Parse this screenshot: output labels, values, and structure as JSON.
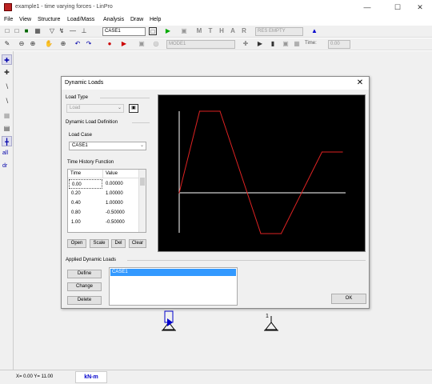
{
  "window": {
    "title": "example1 - time varying forces - LinPro",
    "controls": [
      "—",
      "☐",
      "✕"
    ]
  },
  "menu": [
    "File",
    "View",
    "Structure",
    "Load/Mass",
    "Analysis",
    "Draw",
    "Help"
  ],
  "toolbar1": {
    "load_case_combo": "CASE1",
    "result_combo": "RES EMPTY",
    "text_buttons": [
      "M",
      "T",
      "H",
      "A",
      "R"
    ]
  },
  "toolbar2": {
    "mode_combo": "MODE1",
    "time_label": "Time:",
    "time_value": "0.00"
  },
  "sidebar": {
    "text_items": [
      "all",
      "dr"
    ]
  },
  "status": {
    "coords": "X= 0.00  Y= 11.00",
    "units": "kN-m"
  },
  "canvas": {
    "node_label": "1"
  },
  "dialog": {
    "title": "Dynamic Loads",
    "close": "✕",
    "load_type_label": "Load Type",
    "load_type_value": "Load",
    "definition_label": "Dynamic Load Definition",
    "load_case_label": "Load Case",
    "load_case_value": "CASE1",
    "thf_label": "Time History Function",
    "table": {
      "columns": [
        "Time",
        "Value"
      ],
      "rows": [
        [
          "0.00",
          "0.00000"
        ],
        [
          "0.20",
          "1.00000"
        ],
        [
          "0.40",
          "1.00000"
        ],
        [
          "0.80",
          "-0.50000"
        ],
        [
          "1.00",
          "-0.50000"
        ]
      ]
    },
    "table_buttons": [
      "Open",
      "Scale",
      "Del",
      "Clear"
    ],
    "applied_label": "Applied Dynamic Loads",
    "applied_buttons": [
      "Define",
      "Change",
      "Delete"
    ],
    "applied_items": [
      "CASE1"
    ],
    "ok": "OK"
  },
  "chart_data": {
    "type": "line",
    "title": "",
    "xlabel": "",
    "ylabel": "",
    "x": [
      0.0,
      0.2,
      0.4,
      0.8,
      1.0,
      1.4,
      1.6
    ],
    "series": [
      {
        "values": [
          0.0,
          1.0,
          1.0,
          -0.5,
          -0.5,
          0.5,
          0.5
        ],
        "color": "#dd2222"
      }
    ],
    "xlim": [
      0.0,
      1.6
    ],
    "ylim": [
      -0.5,
      1.0
    ],
    "axis_color": "#ffffff",
    "background": "#000000",
    "grid": false
  }
}
